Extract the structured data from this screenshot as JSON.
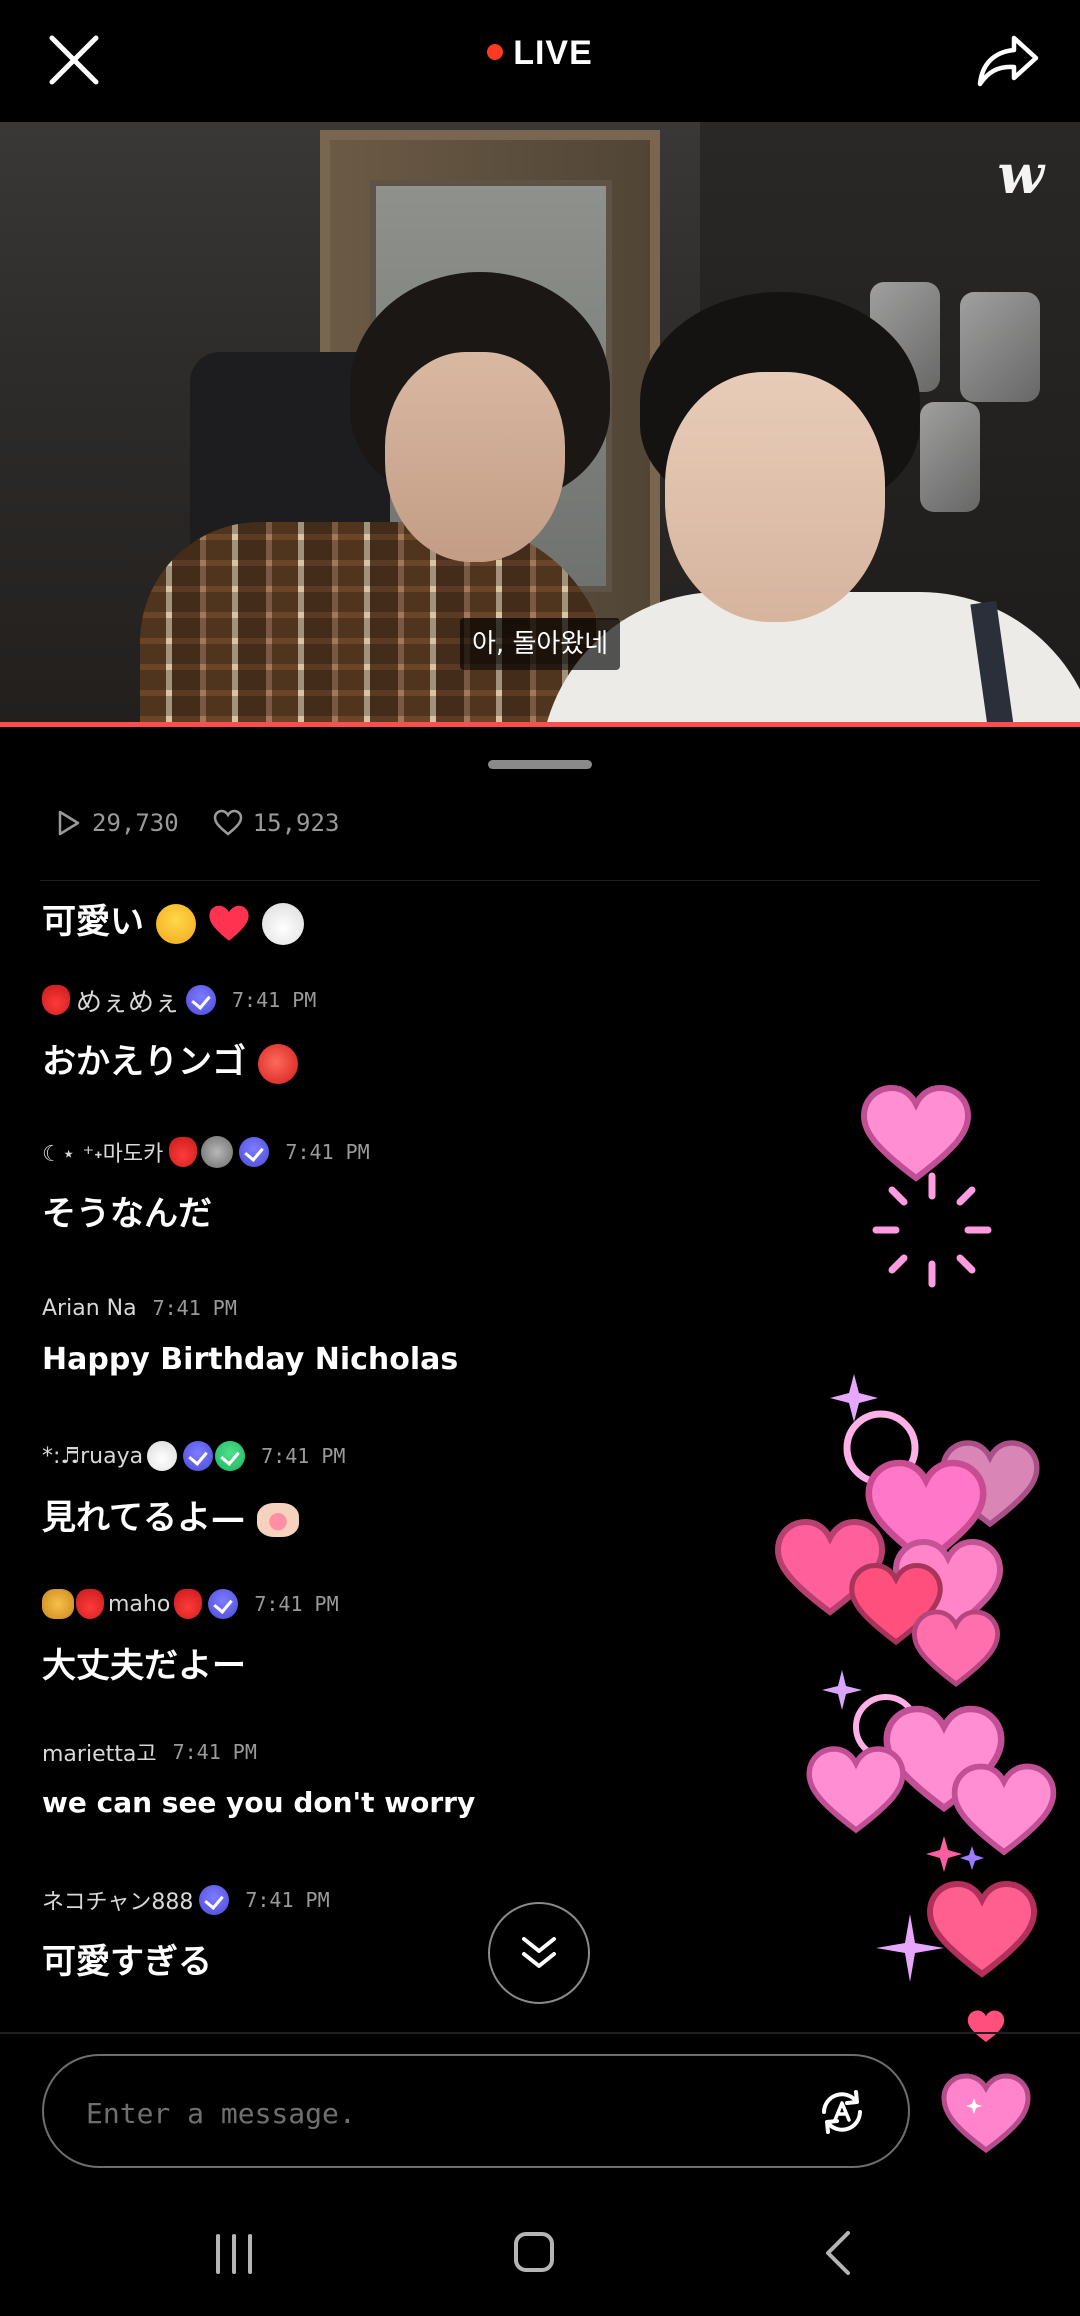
{
  "header": {
    "live_label": "LIVE"
  },
  "video": {
    "logo": "w",
    "caption": "아, 돌아왔네"
  },
  "stats": {
    "plays": "29,730",
    "likes": "15,923"
  },
  "messages": [
    {
      "user": "",
      "time": "",
      "text": "可愛い",
      "emojis": [
        "heart-eyes-emoji",
        "red-heart-emoji",
        "rabbit-emoji"
      ]
    },
    {
      "user": "めぇめぇ",
      "time": "7:41 PM",
      "text": "おかえりンゴ"
    },
    {
      "user": "☾⋆ ⁺˖마도카",
      "time": "7:41 PM",
      "text": "そうなんだ"
    },
    {
      "user": "Arian Na",
      "time": "7:41 PM",
      "text": "Happy Birthday Nicholas"
    },
    {
      "user": "*:♬ruaya",
      "time": "7:41 PM",
      "text": "見れてるよ—"
    },
    {
      "user": "maho",
      "time": "7:41 PM",
      "text": "大丈夫だよー"
    },
    {
      "user": "marietta고",
      "time": "7:41 PM",
      "text": "we can see you don't worry"
    },
    {
      "user": "ネコチャン888",
      "time": "7:41 PM",
      "text": "可愛すぎる"
    }
  ],
  "composer": {
    "placeholder": "Enter a message."
  },
  "colors": {
    "live_dot": "#ff3b1f",
    "progress": "#ff4d4d",
    "badge_blue": "#5d5cf0",
    "badge_green": "#22c46c",
    "heart_pink": "#ff77c8"
  }
}
